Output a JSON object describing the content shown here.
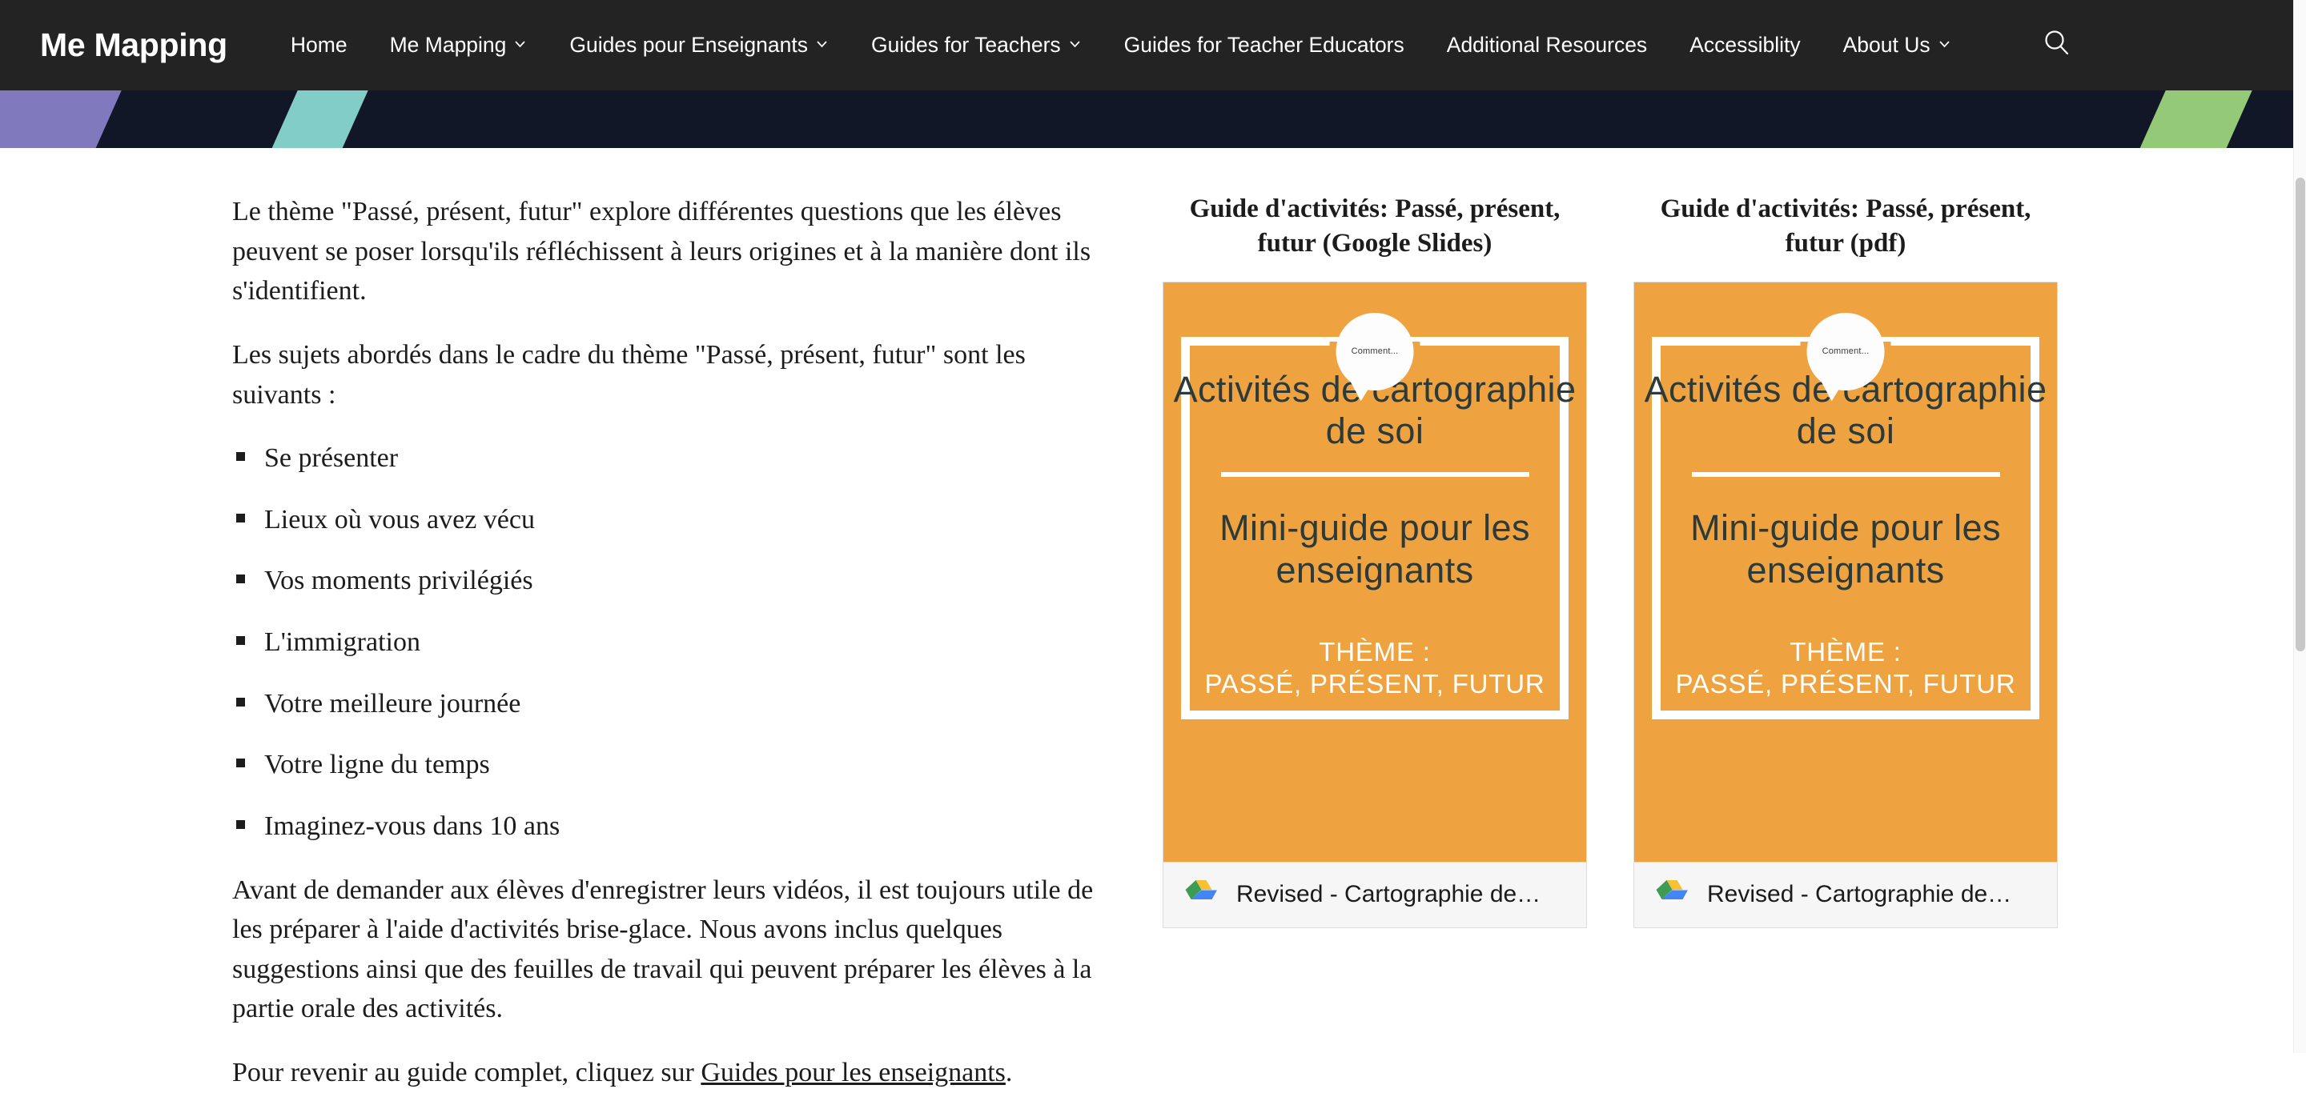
{
  "nav": {
    "brand": "Me Mapping",
    "items": [
      {
        "label": "Home",
        "has_caret": false
      },
      {
        "label": "Me Mapping",
        "has_caret": true
      },
      {
        "label": "Guides pour Enseignants",
        "has_caret": true
      },
      {
        "label": "Guides for Teachers",
        "has_caret": true
      },
      {
        "label": "Guides for Teacher Educators",
        "has_caret": false
      },
      {
        "label": "Additional Resources",
        "has_caret": false
      },
      {
        "label": "Accessiblity",
        "has_caret": false
      },
      {
        "label": "About Us",
        "has_caret": true
      }
    ],
    "search_icon": "search-icon",
    "caret_icon": "chevron-down-icon",
    "background_color": "#232323"
  },
  "banner": {
    "background_color": "#111727",
    "stripe_colors": [
      "#8079bd",
      "#83cdc9",
      "#93c977"
    ]
  },
  "article": {
    "paragraph_1": "Le thème \"Passé, présent, futur\" explore différentes questions que les élèves peuvent se poser lorsqu'ils réfléchissent à leurs origines et à la manière dont ils s'identifient.",
    "paragraph_2": "Les sujets abordés dans le cadre du thème \"Passé, présent, futur\" sont les suivants :",
    "bullets": [
      "Se présenter",
      "Lieux où vous avez vécu",
      "Vos moments privilégiés",
      "L'immigration",
      "Votre meilleure journée",
      "Votre ligne du temps",
      "Imaginez-vous dans 10 ans"
    ],
    "paragraph_3": "Avant de demander aux élèves d'enregistrer leurs vidéos, il est toujours utile de les préparer à l'aide d'activités brise-glace. Nous avons inclus quelques suggestions ainsi que des feuilles de travail qui peuvent préparer les élèves à la partie orale des activités.",
    "closing_prefix": "Pour revenir au guide complet, cliquez sur ",
    "closing_link": "Guides pour les enseignants",
    "closing_suffix": "."
  },
  "cards": [
    {
      "title": "Guide d'activités: Passé, présent, futur (Google Slides)",
      "cover": {
        "bubble_text": "Comment...",
        "headline": "Activités de cartographie de soi",
        "subhead": "Mini-guide pour les enseignants",
        "theme_line_1": "THÈME :",
        "theme_line_2": "PASSÉ, PRÉSENT, FUTUR",
        "background_color": "#efa340",
        "text_color": "#2d3a3a"
      },
      "footer": {
        "icon": "google-drive-icon",
        "filename": "Revised - Cartographie de…"
      }
    },
    {
      "title": "Guide d'activités: Passé, présent, futur (pdf)",
      "cover": {
        "bubble_text": "Comment...",
        "headline": "Activités de cartographie de soi",
        "subhead": "Mini-guide pour les enseignants",
        "theme_line_1": "THÈME :",
        "theme_line_2": "PASSÉ, PRÉSENT, FUTUR",
        "background_color": "#efa340",
        "text_color": "#2d3a3a"
      },
      "footer": {
        "icon": "google-drive-icon",
        "filename": "Revised - Cartographie de…"
      }
    }
  ],
  "scrollbar": {
    "name": "vertical-scrollbar"
  }
}
